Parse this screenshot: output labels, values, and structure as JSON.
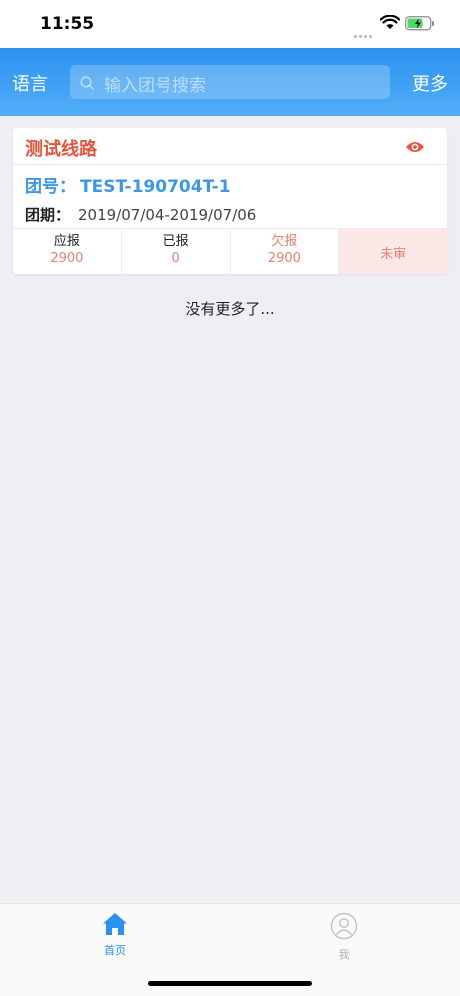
{
  "status_bar": {
    "time": "11:55"
  },
  "nav": {
    "language_label": "语言",
    "search_placeholder": "输入团号搜索",
    "more_label": "更多"
  },
  "card": {
    "route_name": "测试线路",
    "group_label": "团号：",
    "group_number": "TEST-190704T-1",
    "period_label": "团期：",
    "period_value": "2019/07/04-2019/07/06",
    "stats": [
      {
        "label": "应报",
        "value": "2900"
      },
      {
        "label": "已报",
        "value": "0"
      },
      {
        "label": "欠报",
        "value": "2900"
      }
    ],
    "status": "未审"
  },
  "list_footer": "没有更多了...",
  "tabs": [
    {
      "label": "首页",
      "icon": "home-icon",
      "active": true
    },
    {
      "label": "我",
      "icon": "user-icon",
      "active": false
    }
  ],
  "colors": {
    "nav_blue": "#2b91ef",
    "route_red": "#e4553d",
    "group_blue": "#3c98e6",
    "value_red": "#e98172",
    "status_bg": "#fde8e8"
  }
}
